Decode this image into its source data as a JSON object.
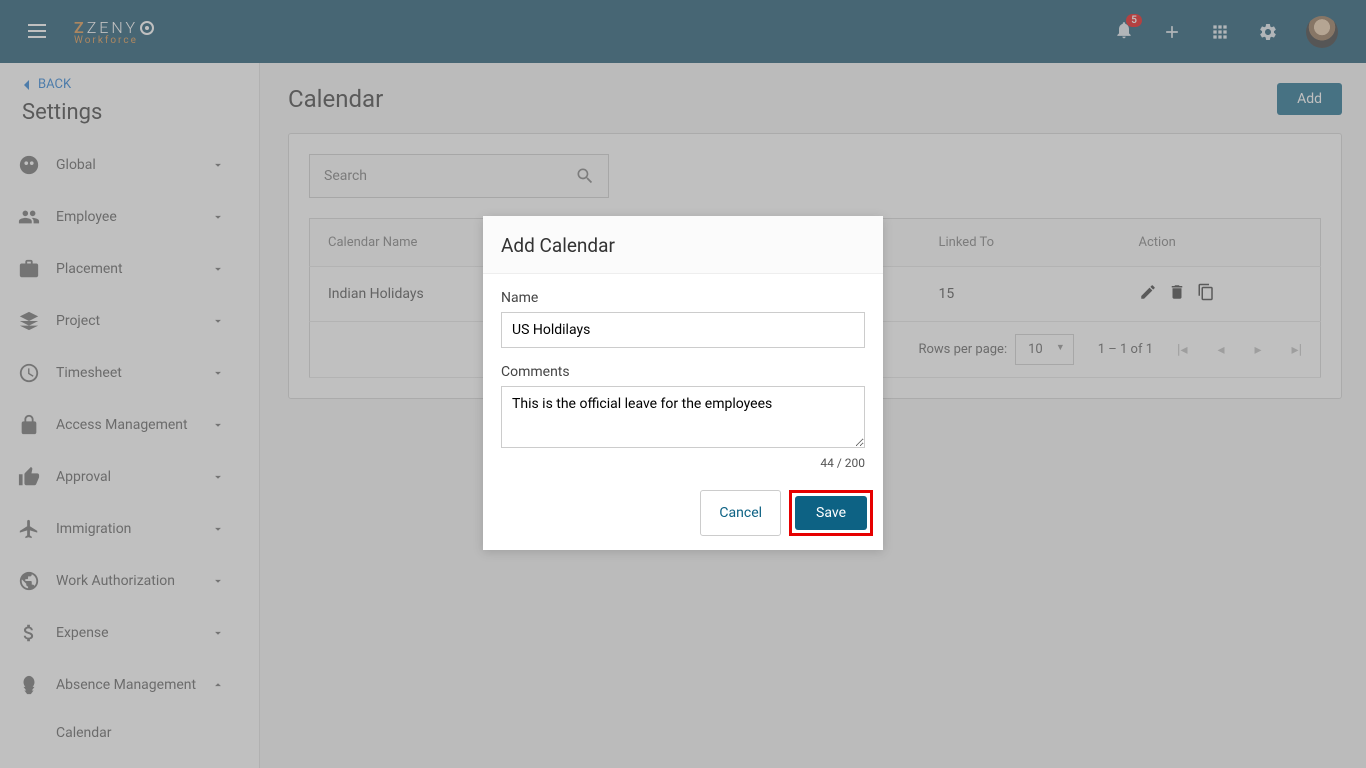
{
  "header": {
    "logo_top": "ZENY",
    "logo_eye": "O",
    "logo_bottom": "Workforce",
    "notif_count": "5"
  },
  "sidebar": {
    "back": "BACK",
    "title": "Settings",
    "items": [
      {
        "label": "Global"
      },
      {
        "label": "Employee"
      },
      {
        "label": "Placement"
      },
      {
        "label": "Project"
      },
      {
        "label": "Timesheet"
      },
      {
        "label": "Access Management"
      },
      {
        "label": "Approval"
      },
      {
        "label": "Immigration"
      },
      {
        "label": "Work Authorization"
      },
      {
        "label": "Expense"
      },
      {
        "label": "Absence Management"
      }
    ],
    "sub_item": "Calendar"
  },
  "main": {
    "title": "Calendar",
    "add_btn": "Add",
    "search_placeholder": "Search",
    "columns": {
      "name": "Calendar Name",
      "linked": "Linked To",
      "action": "Action"
    },
    "row": {
      "name": "Indian Holidays",
      "linked": "15"
    },
    "pagination": {
      "rows_label": "Rows per page:",
      "rows_value": "10",
      "range": "1 – 1 of 1"
    }
  },
  "modal": {
    "title": "Add Calendar",
    "name_label": "Name",
    "name_value": "US Holdilays",
    "comments_label": "Comments",
    "comments_value": "This is the official leave for the employees",
    "char_count": "44 / 200",
    "cancel": "Cancel",
    "save": "Save"
  }
}
